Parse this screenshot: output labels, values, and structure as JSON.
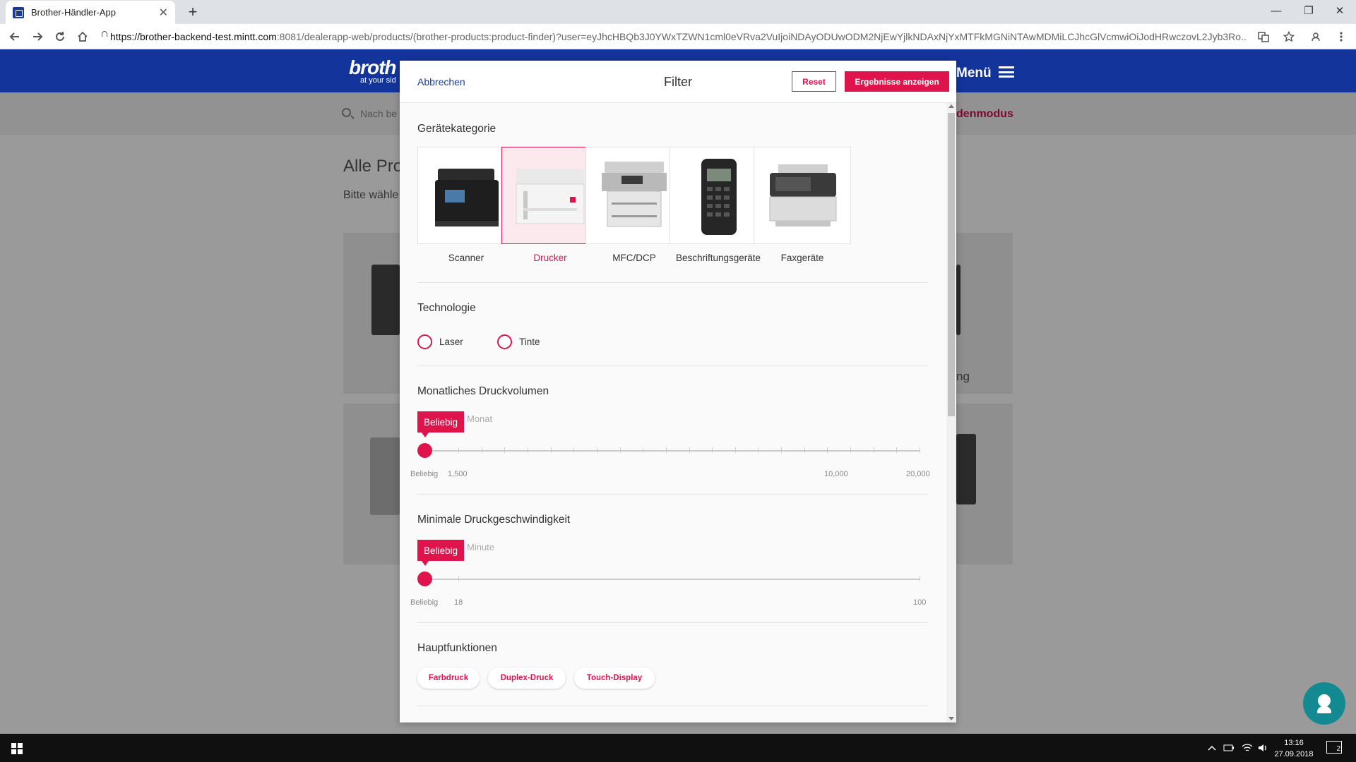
{
  "browser": {
    "tab_title": "Brother-Händler-App",
    "tab_close": "✕",
    "new_tab": "+",
    "url_host": "https://brother-backend-test.mintt.com",
    "url_rest": ":8081/dealerapp-web/products/(brother-products:product-finder)?user=eyJhcHBQb3J0YWxTZWN1cml0eVRva2VuIjoiNDAyODUwODM2NjEwYjlkNDAxNjYxMTFkMGNiNTAwMDMiLCJhcGlVcmwiOiJodHRwczovL2Jyb3Ro...",
    "window_controls": {
      "minimize": "—",
      "restore": "❐",
      "close": "✕"
    }
  },
  "site": {
    "brand": "broth",
    "brand_sub": "at your sid",
    "menu_label": "Menü",
    "search_placeholder": "Nach be",
    "mode_link": "denmodus",
    "page_title": "Alle Pro",
    "page_subtitle": "Bitte wähle",
    "card_partial_text": "ng"
  },
  "modal": {
    "cancel": "Abbrechen",
    "title": "Filter",
    "reset": "Reset",
    "results": "Ergebnisse anzeigen",
    "category_title": "Gerätekategorie",
    "categories": [
      {
        "label": "Scanner",
        "selected": false
      },
      {
        "label": "Drucker",
        "selected": true
      },
      {
        "label": "MFC/DCP",
        "selected": false
      },
      {
        "label": "Beschriftungsgeräte",
        "selected": false
      },
      {
        "label": "Faxgeräte",
        "selected": false
      }
    ],
    "technology_title": "Technologie",
    "technology_options": [
      "Laser",
      "Tinte"
    ],
    "volume_title": "Monatliches Druckvolumen",
    "volume_slider": {
      "value_label": "Beliebig",
      "unit": "Monat",
      "tick_labels": [
        "Beliebig",
        "1,500",
        "10,000",
        "20,000"
      ],
      "value": 0
    },
    "speed_title": "Minimale Druckgeschwindigkeit",
    "speed_slider": {
      "value_label": "Beliebig",
      "unit": "Minute",
      "tick_labels": [
        "Beliebig",
        "18",
        "100"
      ],
      "value": 0
    },
    "functions_title": "Hauptfunktionen",
    "functions": [
      "Farbdruck",
      "Duplex-Druck",
      "Touch-Display"
    ]
  },
  "taskbar": {
    "time": "13:16",
    "date": "27.09.2018",
    "notifications": "2"
  },
  "colors": {
    "accent": "#e0144c",
    "brand_blue": "#13349a",
    "link_blue": "#1b3d9a",
    "help_teal": "#138a91"
  }
}
